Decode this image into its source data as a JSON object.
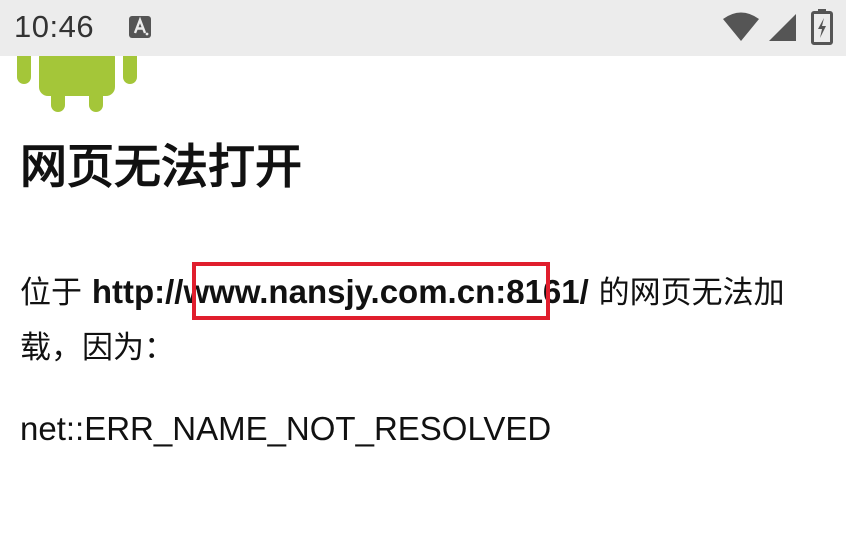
{
  "status_bar": {
    "time": "10:46",
    "notification_icon": "text-a-icon",
    "wifi_icon": "wifi-icon",
    "signal_icon": "cell-signal-icon",
    "battery_icon": "battery-charging-icon",
    "background_color": "#ececec"
  },
  "error_page": {
    "logo_icon": "android-robot-icon",
    "logo_color": "#a4c639",
    "title": "网页无法打开",
    "message_prefix": "位于 ",
    "url": "http://www.nansjy.com.cn:8161/",
    "message_suffix": " 的网页无法加载，因为：",
    "error_code": "net::ERR_NAME_NOT_RESOLVED",
    "highlight_color": "#e01e2d"
  }
}
